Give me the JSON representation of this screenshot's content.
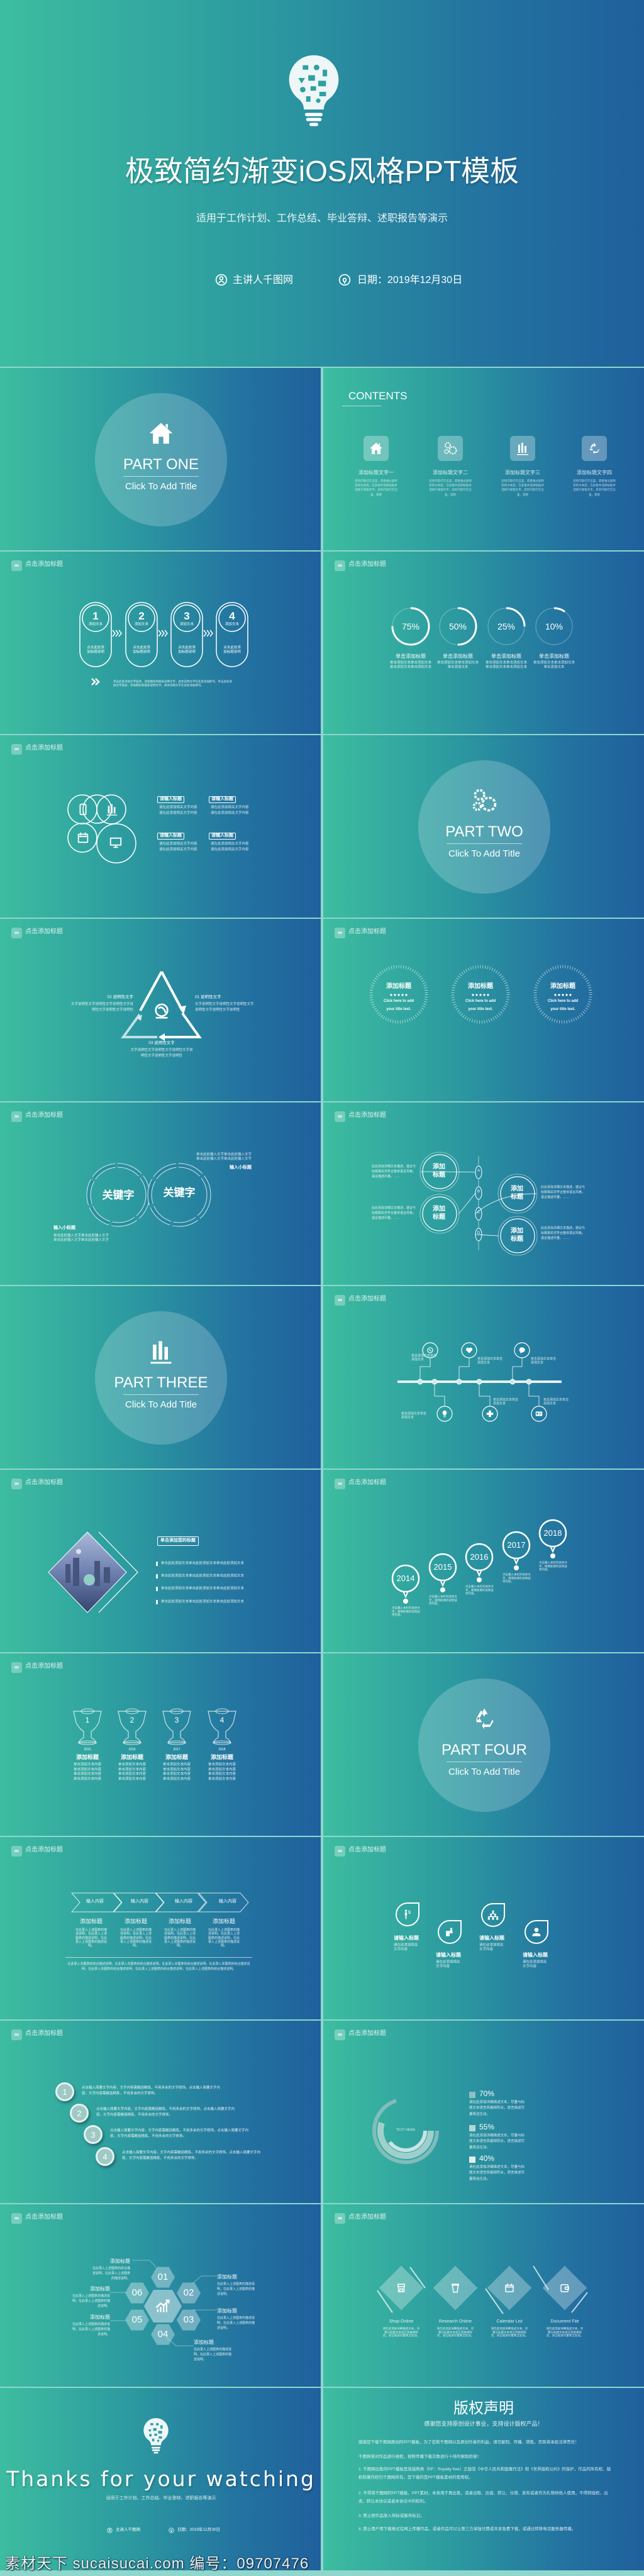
{
  "theme": {
    "gradient_start": "#3dbda0",
    "gradient_end": "#1f609c",
    "text": "#ffffff",
    "divider": "#8fd6cc"
  },
  "slide_header": "点击添加标题",
  "cover": {
    "title": "极致简约渐变iOS风格PPT模板",
    "subtitle": "适用于工作计划、工作总结、毕业答辩、述职报告等演示",
    "presenter": "主讲人千图网",
    "date": "日期：2019年12月30日"
  },
  "parts": [
    {
      "label": "PART ONE",
      "subtitle": "Click To Add Title",
      "icon": "house-icon"
    },
    {
      "label": "PART TWO",
      "subtitle": "Click To Add Title",
      "icon": "gears-icon"
    },
    {
      "label": "PART THREE",
      "subtitle": "Click To Add Title",
      "icon": "bar-chart-icon"
    },
    {
      "label": "PART FOUR",
      "subtitle": "Click To Add Title",
      "icon": "recycle-icon"
    }
  ],
  "contents": {
    "title": "CONTENTS",
    "items": [
      {
        "title": "添加标题文字一",
        "icon": "house-icon",
        "text": "您的内容打在这里，或者通过复制您的文本后，在此框中选择粘贴并选择只保留文字，您的内容打在这里，或者"
      },
      {
        "title": "添加标题文字二",
        "icon": "gears-icon",
        "text": "您的内容打在这里，或者通过复制您的文本后，在此框中选择粘贴并选择只保留文字，您的内容打在这里，或者"
      },
      {
        "title": "添加标题文字三",
        "icon": "bar-chart-icon",
        "text": "您的内容打在这里，或者通过复制您的文本后，在此框中选择粘贴并选择只保留文字，您的内容打在这里，或者"
      },
      {
        "title": "添加标题文字四",
        "icon": "recycle-icon",
        "text": "您的内容打在这里，或者通过复制您的文本后，在此框中选择粘贴并选择只保留文字，您的内容打在这里，或者"
      }
    ]
  },
  "process": {
    "steps": [
      {
        "num": "1",
        "label": "添加文本",
        "text": "点击此处添加标题说明"
      },
      {
        "num": "2",
        "label": "添加文本",
        "text": "点击此处添加标题说明"
      },
      {
        "num": "3",
        "label": "添加文本",
        "text": "点击此处添加标题说明"
      },
      {
        "num": "4",
        "label": "添加文本",
        "text": "点击此处添加标题说明"
      }
    ],
    "note": "单击此处添加文字描述，添加图标和图表说明文字，具体说明文字在此处添加即可。单击此处添加文字描述，添加图标和图表说明文字，具体说明文字在此处添加即可。"
  },
  "progress": {
    "items": [
      {
        "value": "75%",
        "percent": 75,
        "title": "单击添加标题",
        "text": "单击添加文本单击添加文本单击添加文本单击添加文本"
      },
      {
        "value": "50%",
        "percent": 50,
        "title": "单击添加标题",
        "text": "单击添加文本单击添加文本单击添加文本"
      },
      {
        "value": "25%",
        "percent": 25,
        "title": "单击添加标题",
        "text": "单击添加文本单击添加文本单击添加文本单击添加文本"
      },
      {
        "value": "10%",
        "percent": 10,
        "title": "单击添加标题",
        "text": "单击添加文本单击添加文本单击添加文本"
      }
    ]
  },
  "clover": {
    "icons": [
      "phone-icon",
      "bar-chart-icon",
      "calendar-icon",
      "monitor-icon"
    ],
    "items": [
      {
        "title": "请输入标题",
        "text": "请在此添加相关文字内容请在此添加相关文字内容"
      },
      {
        "title": "请输入标题",
        "text": "请在此添加相关文字内容请在此添加相关文字内容"
      },
      {
        "title": "请输入标题",
        "text": "请在此添加相关文字内容请在此添加相关文字内容"
      },
      {
        "title": "请输入标题",
        "text": "请在此添加相关文字内容请在此添加相关文字内容"
      }
    ]
  },
  "cycle": {
    "items": [
      {
        "label": "01 说明性文字",
        "text": "文字说明性文字说明性文字说明性文字说明性文字说明性文字说明性"
      },
      {
        "label": "02 说明性文字",
        "text": "文字说明性文字说明性文字说明性文字说明性文字说明性文字说明性"
      },
      {
        "label": "03 说明性文字",
        "text": "文字说明性文字说明性文字说明性文字说明性文字说明性文字说明性"
      }
    ]
  },
  "badges": {
    "items": [
      {
        "title": "添加标题",
        "line1": "Click here to add",
        "line2": "your title text."
      },
      {
        "title": "添加标题",
        "line1": "Click here to add",
        "line2": "your title text."
      },
      {
        "title": "添加标题",
        "line1": "Click here to add",
        "line2": "your title text."
      }
    ]
  },
  "keywords": {
    "words": [
      "关键字",
      "关键字"
    ],
    "blocks": [
      {
        "title": "输入小标题",
        "text": "单击此处输入文字单击此处输入文字 单击此处输入文字单击此处输入文字"
      },
      {
        "title": "输入小标题",
        "text": "单击此处输入文字单击此处输入文字 单击此处输入文字单击此处输入文字"
      }
    ]
  },
  "branches": {
    "letters": [
      "A",
      "B",
      "C",
      "D"
    ],
    "items": [
      {
        "title": "添加标题",
        "text": "此处添加详细文本描述，建议与标题相关并符合整体语言风格，语言描述尽量。……"
      },
      {
        "title": "添加标题",
        "text": "此处添加详细文本描述，建议与标题相关并符合整体语言风格，语言描述尽量。……"
      },
      {
        "title": "添加标题",
        "text": "此处添加详细文本描述，建议与标题相关并符合整体语言风格，语言描述尽量。……"
      },
      {
        "title": "添加标题",
        "text": "此处添加详细文本描述，建议与标题相关并符合整体语言风格，语言描述尽量。……"
      }
    ]
  },
  "timeline": {
    "items": [
      {
        "icon": "compass-icon",
        "text": "单击添加文本单击添加文本"
      },
      {
        "icon": "heart-icon",
        "text": "单击添加文本单击添加文本"
      },
      {
        "icon": "chat-icon",
        "text": "单击添加文本单击添加文本"
      },
      {
        "icon": "lightbulb-icon",
        "text": "单击添加文本单击添加文本"
      },
      {
        "icon": "plus-icon",
        "text": "单击添加文本单击添加文本"
      },
      {
        "icon": "id-card-icon",
        "text": "单击添加文本单击添加文本"
      }
    ]
  },
  "image_list": {
    "title": "单击添加您的标题",
    "bullets": [
      "单击此处添加文本单击此处添加文本单击此处添加文本",
      "单击此处添加文本单击此处添加文本单击此处添加文本",
      "单击此处添加文本单击此处添加文本单击此处添加文本",
      "单击此处添加文本单击此处添加文本单击此处添加文本"
    ]
  },
  "years": {
    "items": [
      {
        "year": "2014",
        "text": "点击输入本栏的具体文字，简明扼要的说明该项内容。"
      },
      {
        "year": "2015",
        "text": "点击输入本栏的具体文字，简明扼要的说明该项内容。"
      },
      {
        "year": "2016",
        "text": "点击输入本栏的具体文字，简明扼要的说明该项内容。"
      },
      {
        "year": "2017",
        "text": "点击输入本栏的具体文字，简明扼要的说明该项内容。"
      },
      {
        "year": "2018",
        "text": "点击输入本栏的具体文字，简明扼要的说明该项内容。"
      }
    ]
  },
  "trophies": {
    "items": [
      {
        "rank": "1",
        "year": "2015",
        "title": "添加标题",
        "text": "单击添加文本内容 单击添加文本内容 单击添加文本内容 单击添加文本内容"
      },
      {
        "rank": "2",
        "year": "2016",
        "title": "添加标题",
        "text": "单击添加文本内容 单击添加文本内容 单击添加文本内容 单击添加文本内容"
      },
      {
        "rank": "3",
        "year": "2017",
        "title": "添加标题",
        "text": "单击添加文本内容 单击添加文本内容 单击添加文本内容 单击添加文本内容"
      },
      {
        "rank": "4",
        "year": "2018",
        "title": "添加标题",
        "text": "单击添加文本内容 单击添加文本内容 单击添加文本内容 单击添加文本内容"
      }
    ]
  },
  "chevrons": {
    "items": [
      {
        "label": "输入内容",
        "title": "添加标题",
        "text": "在此录入上述图表的描述说明，在此录入上述图表的描述说明，在此录入上述图表的描述说明。"
      },
      {
        "label": "输入内容",
        "title": "添加标题",
        "text": "在此录入上述图表的描述说明，在此录入上述图表的描述说明，在此录入上述图表的描述说明。"
      },
      {
        "label": "输入内容",
        "title": "添加标题",
        "text": "在此录入上述图表的描述说明，在此录入上述图表的描述说明，在此录入上述图表的描述说明。"
      },
      {
        "label": "输入内容",
        "title": "添加标题",
        "text": "在此录入上述图表的描述说明，在此录入上述图表的描述说明，在此录入上述图表的描述说明。"
      }
    ],
    "note": "在此录入本图表的综合描述说明，在此录入本图表的综合描述说明，在此录入本图表的综合描述说明，在此录入本图表的综合描述说明，在此录入本图表的综合描述说明，在此录入上述图表的综合描述说明，在此录入上述图表的综合描述说明。"
  },
  "drops": {
    "items": [
      {
        "icon": "presenter-icon",
        "title": "请输入标题",
        "text": "请在此添加相关文字内容"
      },
      {
        "icon": "desk-icon",
        "title": "请输入标题",
        "text": "请在此添加相关文字内容"
      },
      {
        "icon": "team-icon",
        "title": "请输入标题",
        "text": "请在此添加相关文字内容"
      },
      {
        "icon": "user-icon",
        "title": "请输入标题",
        "text": "请在此添加相关文字内容"
      }
    ]
  },
  "steps": {
    "items": [
      {
        "num": "1",
        "text": "点击输入简要文字内容，文字内容需概括精炼，不用多余的文字修饰。点击输入简要文字内容，文字内容需概括精炼，不用多余的文字修饰。"
      },
      {
        "num": "2",
        "text": "点击输入简要文字内容，文字内容需概括精炼，不用多余的文字修饰。点击输入简要文字内容，文字内容需概括精炼，不用多余的文字修饰。"
      },
      {
        "num": "3",
        "text": "点击输入简要文字内容，文字内容需概括精炼，不用多余的文字修饰。点击输入简要文字内容，文字内容需概括精炼，不用多余的文字修饰。"
      },
      {
        "num": "4",
        "text": "点击输入简要文字内容，文字内容需概括精炼，不用多余的文字修饰。点击输入简要文字内容，文字内容需概括精炼，不用多余的文字修饰。"
      }
    ]
  },
  "rings": {
    "center_label": "TEXT HERE",
    "items": [
      {
        "value": "70%",
        "percent": 70,
        "color": "#8fbfc0",
        "text": "请在此添加详细描述文本，尽量与标题文本语言风格相符合，语言描述尽量简洁生动。"
      },
      {
        "value": "55%",
        "percent": 55,
        "color": "#b3d6d4",
        "text": "请在此添加详细描述文本，尽量与标题文本语言风格相符合，语言描述尽量简洁生动。"
      },
      {
        "value": "40%",
        "percent": 40,
        "color": "#e1f0ee",
        "text": "请在此添加详细描述文本，尽量与标题文本语言风格相符合，语言描述尽量简洁生动。"
      }
    ]
  },
  "hexagons": {
    "center_icon": "trend-up-icon",
    "items": [
      {
        "num": "01",
        "title": "添加标题",
        "text": "在此录入上述图表的综合描述说明，在此录入上述图表的描述说明。"
      },
      {
        "num": "02",
        "title": "添加标题",
        "text": "在此录入上述图表的描述说明，在此录入上述图表的描述说明。"
      },
      {
        "num": "03",
        "title": "添加标题",
        "text": "在此录入上述图表的描述说明，在此录入上述图表的描述说明。"
      },
      {
        "num": "04",
        "title": "添加标题",
        "text": "在此录入上述图表的描述说明，在此录入上述图表的描述说明。"
      },
      {
        "num": "05",
        "title": "添加标题",
        "text": "在此录入上述图表的描述说明，在此录入上述图表的描述说明。"
      },
      {
        "num": "06",
        "title": "添加标题",
        "text": "在此录入上述图表的描述说明，在此录入上述图表的描述说明。"
      }
    ]
  },
  "diamonds": {
    "items": [
      {
        "label": "Shop Online",
        "icon": "shop-icon",
        "text": "请在此添加详细描述文本，尽量与标题文本语言风格相符合，语言描述尽量简洁生动。"
      },
      {
        "label": "Research Online",
        "icon": "cup-icon",
        "text": "请在此添加详细描述文本，尽量与标题文本语言风格相符合，语言描述尽量简洁生动。"
      },
      {
        "label": "Calendar List",
        "icon": "calendar-icon",
        "text": "请在此添加详细描述文本，尽量与标题文本语言风格相符合，语言描述尽量简洁生动。"
      },
      {
        "label": "Document File",
        "icon": "wallet-icon",
        "text": "请在此添加详细描述文本，尽量与标题文本语言风格相符合，语言描述尽量简洁生动。"
      }
    ]
  },
  "thanks": {
    "title": "Thanks for your watching",
    "subtitle": "适用于工作计划、工作总结、毕业答辩、述职报告等演示",
    "presenter": "主讲人千图网",
    "date": "日期：2019年12月30日"
  },
  "copyright": {
    "title": "版权声明",
    "subtitle": "感谢您支持原创设计事业，支持设计版权产品！",
    "paragraphs": [
      "感谢您下载千图网原创的PPT模板，为了您和千图网以及原创作者的利益，请勿复制、传播、销售，否则将承担法律责任！",
      "千图网将对作品进行维权，按照传播下载次数进行十倍的索取赔偿！",
      "1. 千图网出售的PPT模板是免版税类（RF：Royalty free）正版受《中华人民共和国著作法》和《世界版权公约》的保护，作品的所有权、版权和著作权归千图网所有，您下载的是PPT模板素材的使用权。",
      "2. 不得将千图网的PPT模板、PPT素材，本身用于再出售，或者出租、出借、转让、分销、发布或者作为礼物供他人使用，不得转授权、出卖、转让本协议或者本协议中的权利。",
      "3. 禁止把作品放入商标或服务标记。",
      "4. 禁止用户用下载格式在网上传播作品，或者作品可以让第三方单独付费或共享免费下载，或通过转移电话服务器传播。"
    ]
  },
  "watermark": "素材天下 sucaisucai.com  编号：09707476"
}
